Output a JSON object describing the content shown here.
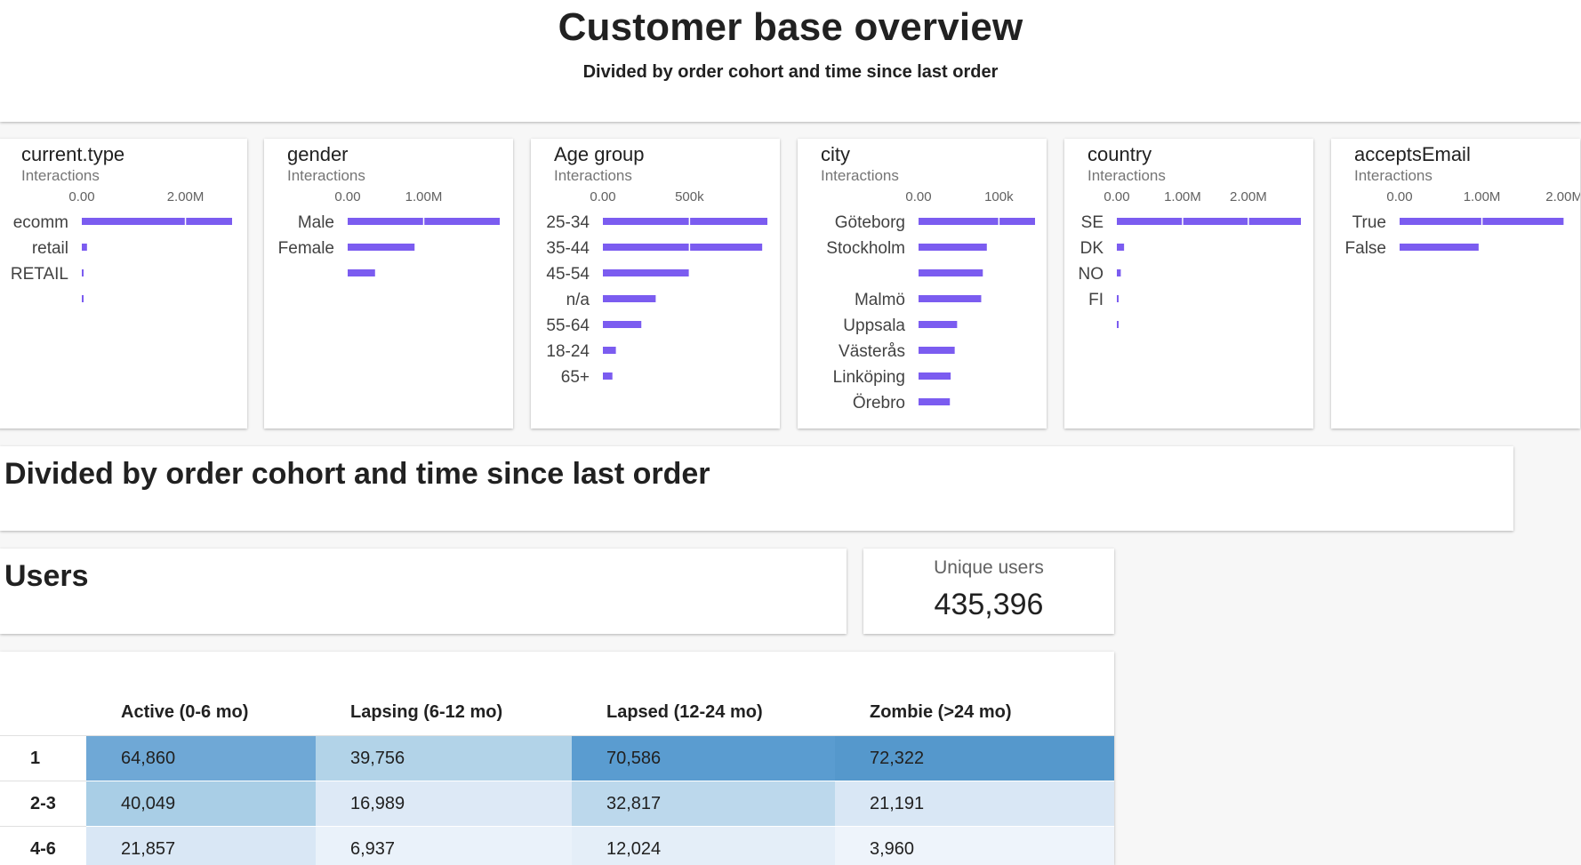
{
  "header": {
    "title": "Customer base overview",
    "subtitle": "Divided by order cohort and time since last order"
  },
  "bar_color": "#7b5cf0",
  "chart_data": [
    {
      "type": "bar",
      "orientation": "horizontal",
      "title": "current.type",
      "subtitle": "Interactions",
      "xlim": [
        0,
        2900000
      ],
      "tick_values": [
        0,
        2000000
      ],
      "tick_labels": [
        "0.00",
        "2.00M"
      ],
      "categories": [
        "ecomm",
        "retail",
        "RETAIL",
        ""
      ],
      "values": [
        2900000,
        100000,
        30000,
        20000
      ]
    },
    {
      "type": "bar",
      "orientation": "horizontal",
      "title": "gender",
      "subtitle": "Interactions",
      "xlim": [
        0,
        2000000
      ],
      "tick_values": [
        0,
        1000000
      ],
      "tick_labels": [
        "0.00",
        "1.00M"
      ],
      "categories": [
        "Male",
        "Female",
        ""
      ],
      "values": [
        2000000,
        880000,
        360000
      ]
    },
    {
      "type": "bar",
      "orientation": "horizontal",
      "title": "Age group",
      "subtitle": "Interactions",
      "xlim": [
        0,
        950000
      ],
      "tick_values": [
        0,
        500000
      ],
      "tick_labels": [
        "0.00",
        "500k"
      ],
      "categories": [
        "25-34",
        "35-44",
        "45-54",
        "n/a",
        "55-64",
        "18-24",
        "65+"
      ],
      "values": [
        950000,
        920000,
        500000,
        305000,
        222000,
        75000,
        55000
      ]
    },
    {
      "type": "bar",
      "orientation": "horizontal",
      "title": "city",
      "subtitle": "Interactions",
      "xlim": [
        0,
        145000
      ],
      "tick_values": [
        0,
        100000
      ],
      "tick_labels": [
        "0.00",
        "100k"
      ],
      "categories": [
        "Göteborg",
        "Stockholm",
        "",
        "Malmö",
        "Uppsala",
        "Västerås",
        "Linköping",
        "Örebro"
      ],
      "values": [
        145000,
        85000,
        80000,
        78000,
        48000,
        45000,
        40000,
        39000
      ]
    },
    {
      "type": "bar",
      "orientation": "horizontal",
      "title": "country",
      "subtitle": "Interactions",
      "xlim": [
        0,
        2800000
      ],
      "tick_values": [
        0,
        1000000,
        2000000
      ],
      "tick_labels": [
        "0.00",
        "1.00M",
        "2.00M"
      ],
      "categories": [
        "SE",
        "DK",
        "NO",
        "FI",
        ""
      ],
      "values": [
        2800000,
        110000,
        60000,
        25000,
        20000
      ]
    },
    {
      "type": "bar",
      "orientation": "horizontal",
      "title": "acceptsEmail",
      "subtitle": "Interactions",
      "xlim": [
        0,
        2020000
      ],
      "tick_values": [
        0,
        1000000,
        2000000
      ],
      "tick_labels": [
        "0.00",
        "1.00M",
        "2.00M"
      ],
      "categories": [
        "True",
        "False"
      ],
      "values": [
        2000000,
        960000
      ]
    }
  ],
  "section": {
    "title": "Divided by order cohort and time since last order"
  },
  "users": {
    "title": "Users"
  },
  "kpi": {
    "label": "Unique users",
    "value": "435,396"
  },
  "table": {
    "columns": [
      "Active (0-6 mo)",
      "Lapsing (6-12 mo)",
      "Lapsed (12-24 mo)",
      "Zombie (>24 mo)"
    ],
    "rows": [
      {
        "label": "1",
        "cells": [
          "64,860",
          "39,756",
          "70,586",
          "72,322"
        ],
        "colors": [
          "#6fa8d6",
          "#b2d3e8",
          "#5a9cd0",
          "#5598cc"
        ]
      },
      {
        "label": "2-3",
        "cells": [
          "40,049",
          "16,989",
          "32,817",
          "21,191"
        ],
        "colors": [
          "#a9cee6",
          "#dde9f6",
          "#bcd8ec",
          "#d9e7f5"
        ]
      },
      {
        "label": "4-6",
        "cells": [
          "21,857",
          "6,937",
          "12,024",
          "3,960"
        ],
        "colors": [
          "#d9e7f5",
          "#eaf2fa",
          "#e4eef8",
          "#eef4fb"
        ]
      }
    ]
  }
}
